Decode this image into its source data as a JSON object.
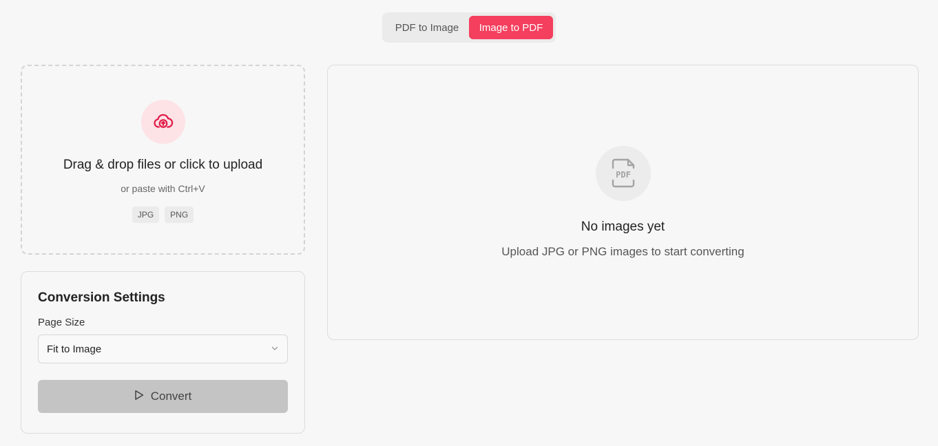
{
  "mode_toggle": {
    "tabs": [
      {
        "label": "PDF to Image",
        "active": false
      },
      {
        "label": "Image to PDF",
        "active": true
      }
    ],
    "active_color": "#f43f5e"
  },
  "upload": {
    "icon": "cloud-upload-icon",
    "title": "Drag & drop files or click to upload",
    "subtitle": "or paste with Ctrl+V",
    "formats": [
      "JPG",
      "PNG"
    ]
  },
  "settings": {
    "title": "Conversion Settings",
    "page_size_label": "Page Size",
    "page_size_value": "Fit to Image",
    "convert_label": "Convert"
  },
  "preview": {
    "icon": "pdf-file-icon",
    "empty_title": "No images yet",
    "empty_subtitle": "Upload JPG or PNG images to start converting"
  }
}
